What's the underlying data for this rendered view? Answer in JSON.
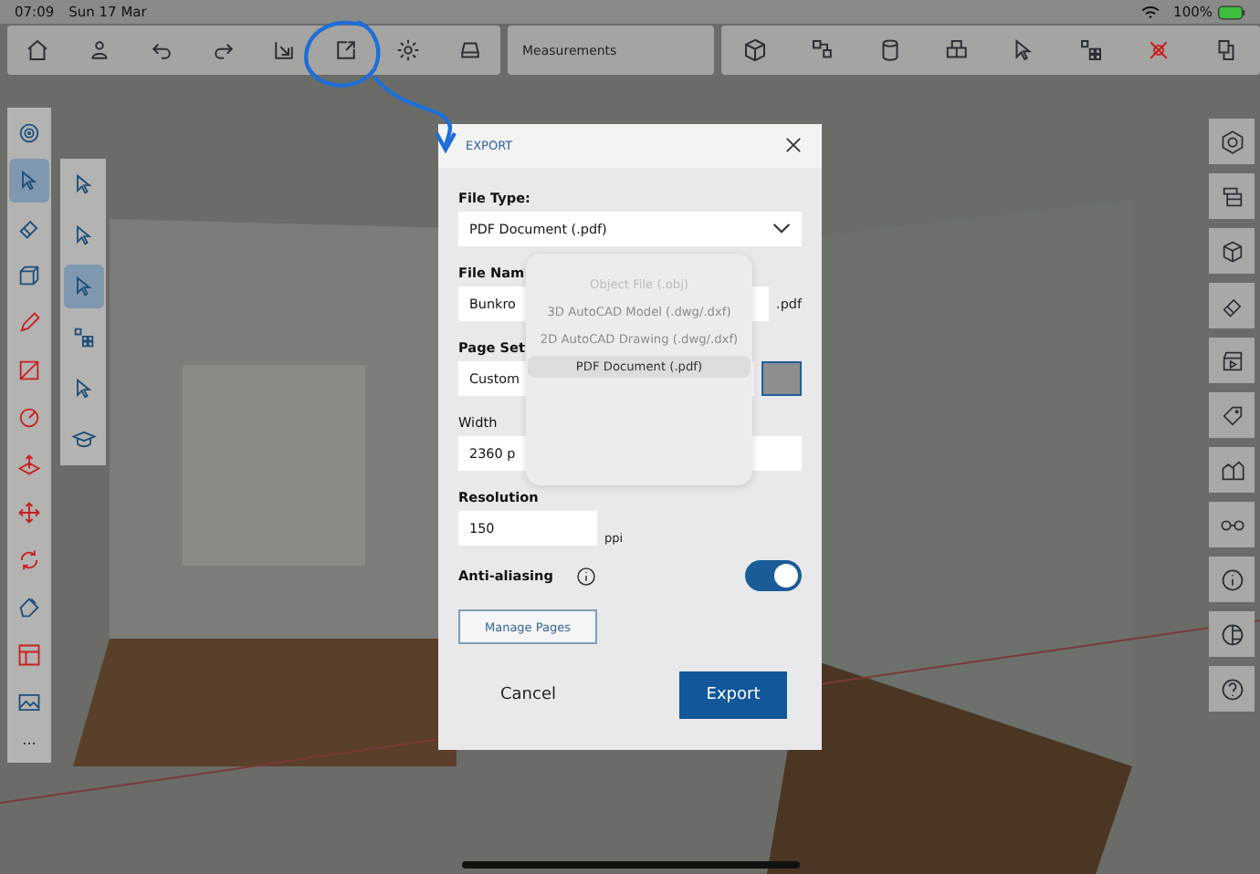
{
  "status_bar": {
    "time": "07:09",
    "date": "Sun 17 Mar",
    "battery": "100%"
  },
  "top_toolbar": {
    "measurements": "Measurements"
  },
  "left_toolbar": {
    "tools": [
      {
        "selected": false
      },
      {
        "selected": true
      },
      {
        "selected": false
      },
      {
        "selected": false
      },
      {
        "selected": false
      },
      {
        "selected": false
      },
      {
        "selected": false
      },
      {
        "selected": false
      },
      {
        "selected": false
      },
      {
        "selected": false
      },
      {
        "selected": false
      },
      {
        "selected": false
      },
      {
        "selected": false
      }
    ],
    "more": "..."
  },
  "select_submenu": {
    "tools": [
      {
        "selected": false
      },
      {
        "selected": false
      },
      {
        "selected": true
      },
      {
        "selected": false
      },
      {
        "selected": false
      },
      {
        "selected": false
      }
    ]
  },
  "export_dialog": {
    "title": "EXPORT",
    "file_type": {
      "label": "File Type:",
      "value": "PDF Document (.pdf)",
      "options": [
        {
          "label": "Object File (.obj)",
          "selected": false,
          "disabled": true
        },
        {
          "label": "3D AutoCAD Model (.dwg/.dxf)",
          "selected": false,
          "disabled": false
        },
        {
          "label": "2D AutoCAD Drawing (.dwg/.dxf)",
          "selected": false,
          "disabled": false
        },
        {
          "label": "PDF Document (.pdf)",
          "selected": true,
          "disabled": false
        }
      ]
    },
    "file_name": {
      "label": "File Nam",
      "value": "Bunkro",
      "extension": ".pdf"
    },
    "page_setup": {
      "label": "Page Set",
      "value": "Custom"
    },
    "width": {
      "label": "Width",
      "value": "2360 p"
    },
    "resolution": {
      "label": "Resolution",
      "value": "150",
      "unit": "ppi"
    },
    "anti_aliasing": {
      "label": "Anti-aliasing",
      "on": true
    },
    "manage_pages": "Manage Pages",
    "cancel": "Cancel",
    "export": "Export"
  }
}
